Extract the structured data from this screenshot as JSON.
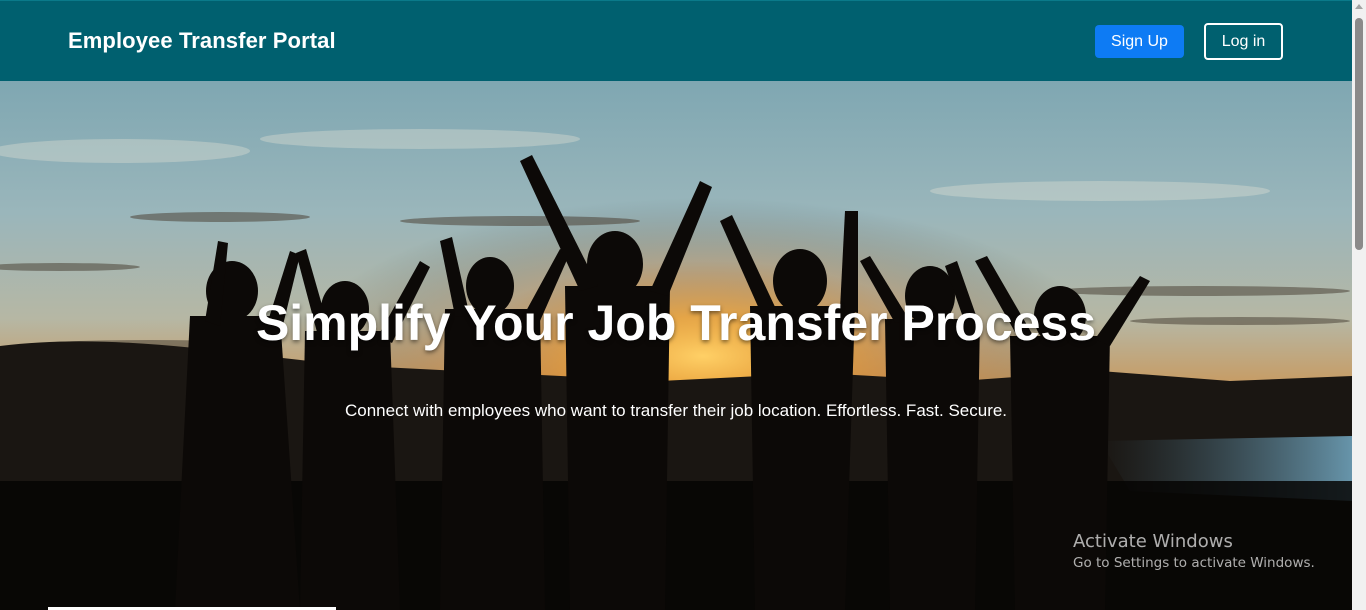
{
  "header": {
    "brand": "Employee Transfer Portal",
    "signup_label": "Sign Up",
    "login_label": "Log in"
  },
  "hero": {
    "title": "Simplify Your Job Transfer Process",
    "subtitle": "Connect with employees who want to transfer their job location. Effortless. Fast. Secure."
  },
  "watermark": {
    "line1": "Activate Windows",
    "line2": "Go to Settings to activate Windows."
  },
  "colors": {
    "navbar": "#00606f",
    "signup_button": "#0d7bf4"
  }
}
